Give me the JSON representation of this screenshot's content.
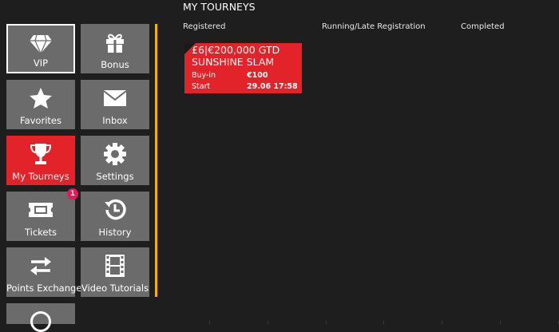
{
  "header": {
    "title": "MY TOURNEYS"
  },
  "tabs": [
    {
      "label": "Registered"
    },
    {
      "label": "Running/Late Registration"
    },
    {
      "label": "Completed"
    }
  ],
  "menu": {
    "items": [
      {
        "label": "VIP",
        "icon": "diamond-icon"
      },
      {
        "label": "Bonus",
        "icon": "gift-icon"
      },
      {
        "label": "Favorites",
        "icon": "star-icon"
      },
      {
        "label": "Inbox",
        "icon": "envelope-icon"
      },
      {
        "label": "My Tourneys",
        "icon": "trophy-icon"
      },
      {
        "label": "Settings",
        "icon": "gear-icon"
      },
      {
        "label": "Tickets",
        "icon": "ticket-icon",
        "badge": "1"
      },
      {
        "label": "History",
        "icon": "history-icon"
      },
      {
        "label": "Points Exchange",
        "icon": "exchange-arrows-icon"
      },
      {
        "label": "Video Tutorials",
        "icon": "film-icon"
      }
    ]
  },
  "tourney": {
    "name_line1": "£6|€200,000 GTD",
    "name_line2": "SUNSHINE SLAM",
    "buyin_label": "Buy-in",
    "buyin_value": "€100",
    "start_label": "Start",
    "start_value": "29.06 17:58"
  },
  "colors": {
    "accent_red": "#e2232a",
    "divider_yellow": "#f0b400",
    "tile_gray": "#6b6b6b",
    "badge_pink": "#e8175d",
    "background": "#1e1e1e"
  }
}
